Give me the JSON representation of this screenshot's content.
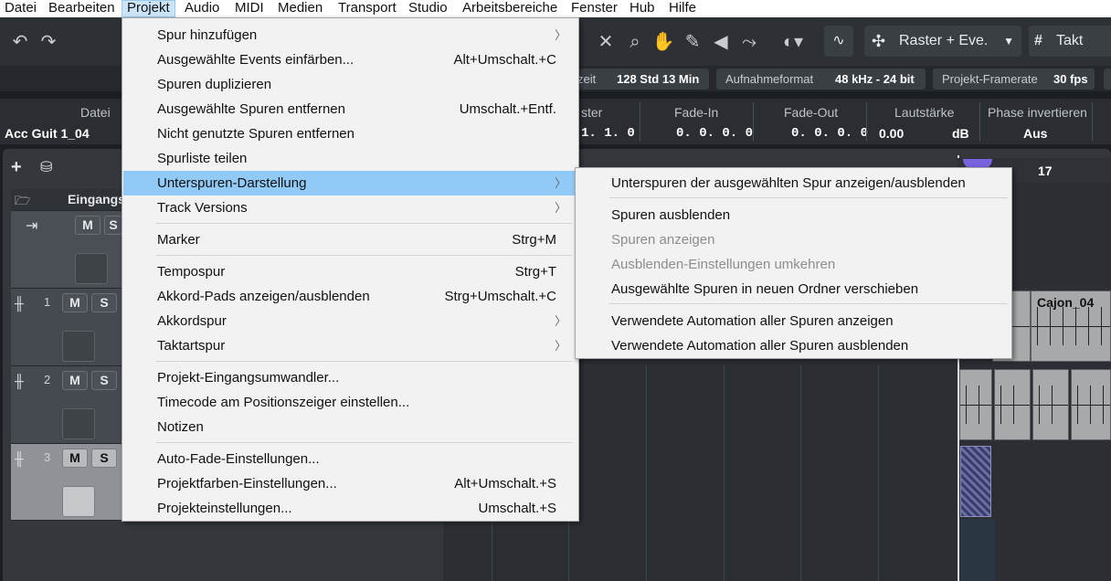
{
  "menubar": [
    "Datei",
    "Bearbeiten",
    "Projekt",
    "Audio",
    "MIDI",
    "Medien",
    "Transport",
    "Studio",
    "Arbeitsbereiche",
    "Fenster",
    "Hub",
    "Hilfe"
  ],
  "toolbar": {
    "snap_type": "Raster + Eve.",
    "grid_type": "Takt"
  },
  "infobar": {
    "record_time_label": "zeit",
    "record_time_value": "128 Std 13 Min",
    "record_format_label": "Aufnahmeformat",
    "record_format_value": "48 kHz - 24 bit",
    "framerate_label": "Projekt-Framerate",
    "framerate_value": "30 fps"
  },
  "infoline": {
    "file_label": "Datei",
    "file_value": "Acc Guit 1_04",
    "snap_label": "ster",
    "snap_value": "1. 1.  0",
    "fadein_label": "Fade-In",
    "fadein_value": "0. 0. 0.  0",
    "fadeout_label": "Fade-Out",
    "fadeout_value": "0. 0. 0.  0",
    "volume_label": "Lautstärke",
    "volume_value": "0.00",
    "volume_unit": "dB",
    "phase_label": "Phase invertieren",
    "phase_value": "Aus"
  },
  "tracks": {
    "folder_label": "Eingangs",
    "mute": "M",
    "solo": "S",
    "numbers": [
      "1",
      "2",
      "3"
    ]
  },
  "ruler": {
    "bar": "17"
  },
  "event_name": "Cajon_04",
  "project_menu": {
    "items": [
      {
        "label": "Spur hinzufügen",
        "shortcut": "",
        "submenu": true
      },
      {
        "label": "Ausgewählte Events einfärben...",
        "shortcut": "Alt+Umschalt.+C",
        "submenu": false
      },
      {
        "label": "Spuren duplizieren",
        "shortcut": "",
        "submenu": false
      },
      {
        "label": "Ausgewählte Spuren entfernen",
        "shortcut": "Umschalt.+Entf.",
        "submenu": false
      },
      {
        "label": "Nicht genutzte Spuren entfernen",
        "shortcut": "",
        "submenu": false
      },
      {
        "label": "Spurliste teilen",
        "shortcut": "",
        "submenu": false
      },
      {
        "label": "Unterspuren-Darstellung",
        "shortcut": "",
        "submenu": true
      },
      {
        "label": "Track Versions",
        "shortcut": "",
        "submenu": true
      },
      {
        "label": "Marker",
        "shortcut": "Strg+M",
        "submenu": false
      },
      {
        "label": "Tempospur",
        "shortcut": "Strg+T",
        "submenu": false
      },
      {
        "label": "Akkord-Pads anzeigen/ausblenden",
        "shortcut": "Strg+Umschalt.+C",
        "submenu": false
      },
      {
        "label": "Akkordspur",
        "shortcut": "",
        "submenu": true
      },
      {
        "label": "Taktartspur",
        "shortcut": "",
        "submenu": true
      },
      {
        "label": "Projekt-Eingangsumwandler...",
        "shortcut": "",
        "submenu": false
      },
      {
        "label": "Timecode am Positionszeiger einstellen...",
        "shortcut": "",
        "submenu": false
      },
      {
        "label": "Notizen",
        "shortcut": "",
        "submenu": false
      },
      {
        "label": "Auto-Fade-Einstellungen...",
        "shortcut": "",
        "submenu": false
      },
      {
        "label": "Projektfarben-Einstellungen...",
        "shortcut": "Alt+Umschalt.+S",
        "submenu": false
      },
      {
        "label": "Projekteinstellungen...",
        "shortcut": "Umschalt.+S",
        "submenu": false
      }
    ]
  },
  "submenu": {
    "items": [
      {
        "label": "Unterspuren der ausgewählten Spur anzeigen/ausblenden",
        "disabled": false
      },
      {
        "label": "Spuren ausblenden",
        "disabled": false
      },
      {
        "label": "Spuren anzeigen",
        "disabled": true
      },
      {
        "label": "Ausblenden-Einstellungen umkehren",
        "disabled": true
      },
      {
        "label": "Ausgewählte Spuren in neuen Ordner verschieben",
        "disabled": false
      },
      {
        "label": "Verwendete Automation aller Spuren anzeigen",
        "disabled": false
      },
      {
        "label": "Verwendete Automation aller Spuren ausblenden",
        "disabled": false
      }
    ]
  },
  "colors": {
    "highlight": "#91c9f7",
    "menubar_active": "#cce4f7",
    "cursor": "#7a63e0"
  }
}
